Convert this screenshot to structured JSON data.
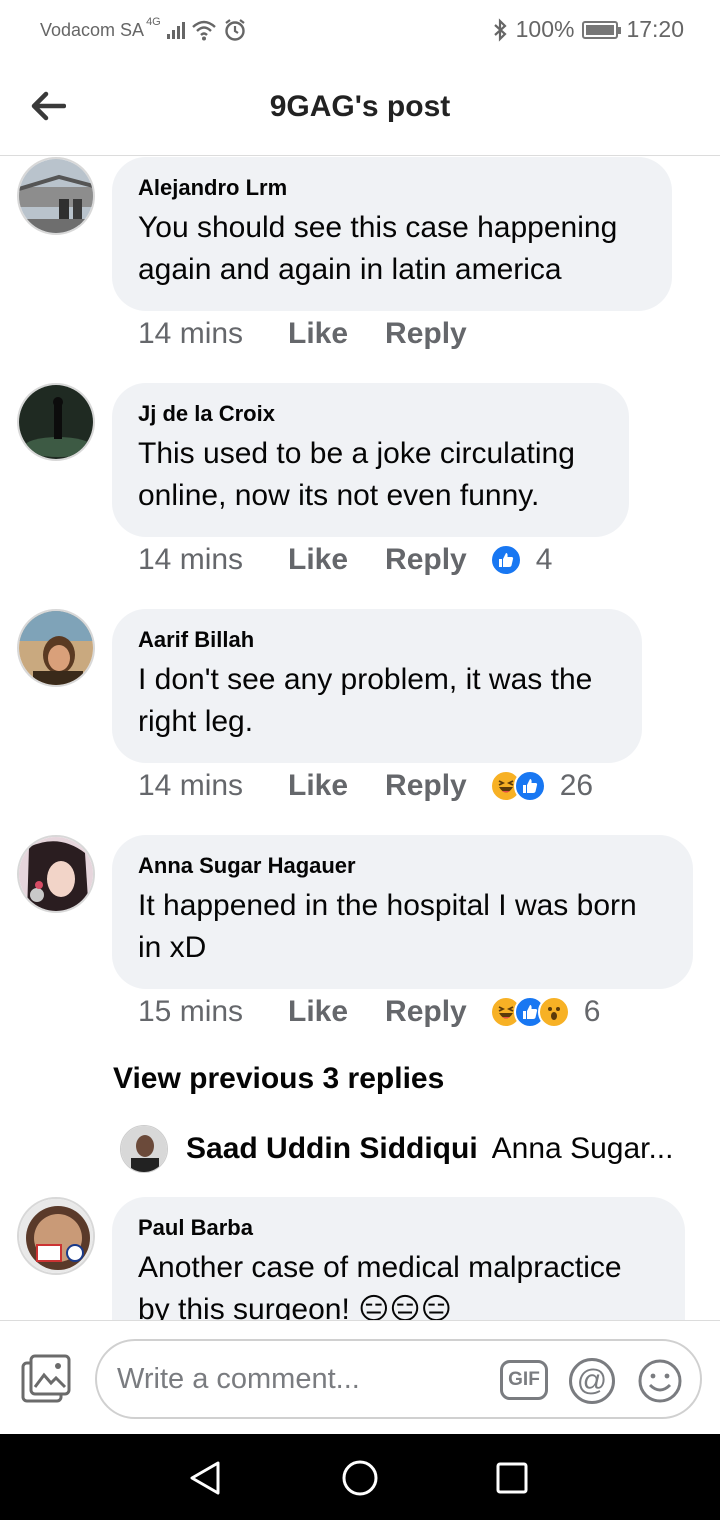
{
  "status_bar": {
    "carrier": "Vodacom SA",
    "network": "4G",
    "battery": "100%",
    "battery_level": 1.0,
    "time": "17:20"
  },
  "header": {
    "title": "9GAG's post",
    "back_icon": "arrow-left-icon"
  },
  "comments": [
    {
      "author": "Alejandro Lrm",
      "text_lines": [
        "You should see this case happening",
        "again and again in latin america"
      ],
      "time": "14 mins",
      "like_label": "Like",
      "reply_label": "Reply",
      "reactions": [],
      "reaction_count": ""
    },
    {
      "author": "Jj de la Croix",
      "text_lines": [
        "This used to be a joke circulating",
        "online, now its not even funny."
      ],
      "time": "14 mins",
      "like_label": "Like",
      "reply_label": "Reply",
      "reactions": [
        "like"
      ],
      "reaction_count": "4"
    },
    {
      "author": "Aarif Billah",
      "text_lines": [
        "I don't see any problem, it was the",
        "right leg."
      ],
      "time": "14 mins",
      "like_label": "Like",
      "reply_label": "Reply",
      "reactions": [
        "haha",
        "like"
      ],
      "reaction_count": "26"
    },
    {
      "author": "Anna Sugar Hagauer",
      "text_lines": [
        "It happened in the hospital I was born",
        "in xD"
      ],
      "time": "15 mins",
      "like_label": "Like",
      "reply_label": "Reply",
      "reactions": [
        "haha",
        "like",
        "wow"
      ],
      "reaction_count": "6"
    },
    {
      "author": "Paul Barba",
      "text_lines": [
        "Another case of medical malpractice",
        "by this surgeon! 😑😑😑"
      ]
    }
  ],
  "view_replies": "View previous 3 replies",
  "reply_preview": {
    "name": "Saad Uddin Siddiqui",
    "snippet": "Anna Sugar..."
  },
  "composer": {
    "placeholder": "Write a comment...",
    "gif_label": "GIF",
    "mention_label": "@"
  },
  "colors": {
    "bubble": "#f0f2f5",
    "meta_text": "#65676b",
    "like_blue": "#1877f2",
    "reaction_yellow": "#f7b125"
  }
}
